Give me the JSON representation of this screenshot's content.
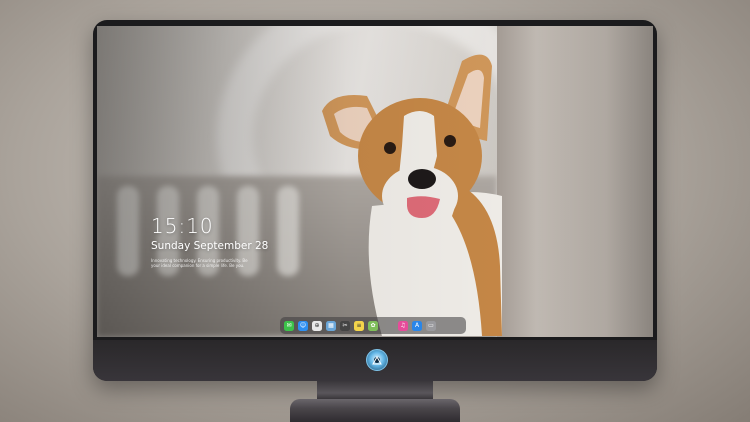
{
  "lockscreen": {
    "time": "15:10",
    "date": "Sunday September 28",
    "tagline_line1": "Innovating technology. Ensuring productivity. Be",
    "tagline_line2": "your ideal companion for a simple life. Be you."
  },
  "dock": {
    "icons": [
      {
        "name": "messages-icon",
        "color": "#3cc24a",
        "glyph": "✉"
      },
      {
        "name": "finder-icon",
        "color": "#2e8ff0",
        "glyph": "☺"
      },
      {
        "name": "safari-icon",
        "color": "#e8e8e8",
        "glyph": "⊕"
      },
      {
        "name": "preview-icon",
        "color": "#6aa6d8",
        "glyph": "▦"
      },
      {
        "name": "movie-icon",
        "color": "#444444",
        "glyph": "✂"
      },
      {
        "name": "notes-icon",
        "color": "#f4d54b",
        "glyph": "≡"
      },
      {
        "name": "photos-icon",
        "color": "#7fbf5a",
        "glyph": "✿"
      },
      {
        "name": "music-icon",
        "color": "#e64c9a",
        "glyph": "♫"
      },
      {
        "name": "appstore-icon",
        "color": "#2a86e8",
        "glyph": "A"
      },
      {
        "name": "trash-icon",
        "color": "#9a9a9e",
        "glyph": "▭"
      }
    ]
  },
  "colors": {
    "bezel": "#1b1b1d",
    "chin": "#38353a",
    "logo_accent": "#62b6e6"
  }
}
